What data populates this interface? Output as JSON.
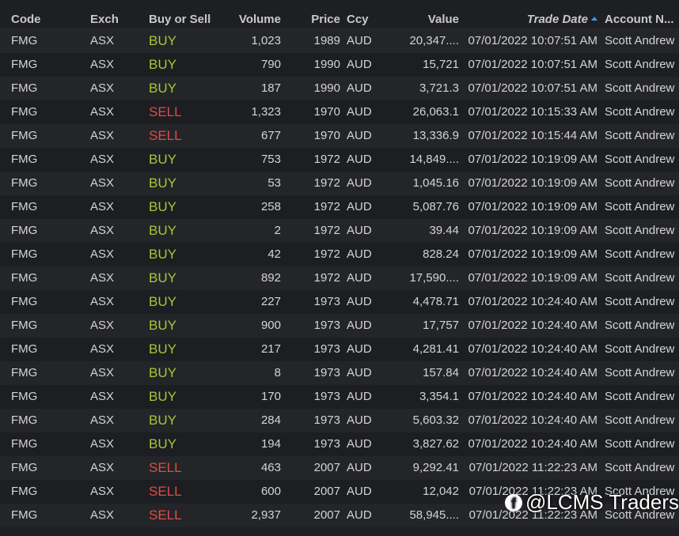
{
  "columns": {
    "code": "Code",
    "exch": "Exch",
    "side": "Buy or Sell",
    "volume": "Volume",
    "price": "Price",
    "ccy": "Ccy",
    "value": "Value",
    "trade_date": "Trade Date",
    "account": "Account N..."
  },
  "sort": {
    "column": "trade_date",
    "direction": "ascending",
    "icon": "sort-up-icon"
  },
  "colors": {
    "buy": "#a3c93a",
    "sell": "#e24a4a",
    "sort_arrow": "#3b9be8"
  },
  "rows": [
    {
      "code": "FMG",
      "exch": "ASX",
      "side": "BUY",
      "volume": "1,023",
      "price": "1989",
      "ccy": "AUD",
      "value": "20,347....",
      "trade_date": "07/01/2022 10:07:51 AM",
      "account": "Scott Andrew"
    },
    {
      "code": "FMG",
      "exch": "ASX",
      "side": "BUY",
      "volume": "790",
      "price": "1990",
      "ccy": "AUD",
      "value": "15,721",
      "trade_date": "07/01/2022 10:07:51 AM",
      "account": "Scott Andrew"
    },
    {
      "code": "FMG",
      "exch": "ASX",
      "side": "BUY",
      "volume": "187",
      "price": "1990",
      "ccy": "AUD",
      "value": "3,721.3",
      "trade_date": "07/01/2022 10:07:51 AM",
      "account": "Scott Andrew"
    },
    {
      "code": "FMG",
      "exch": "ASX",
      "side": "SELL",
      "volume": "1,323",
      "price": "1970",
      "ccy": "AUD",
      "value": "26,063.1",
      "trade_date": "07/01/2022 10:15:33 AM",
      "account": "Scott Andrew"
    },
    {
      "code": "FMG",
      "exch": "ASX",
      "side": "SELL",
      "volume": "677",
      "price": "1970",
      "ccy": "AUD",
      "value": "13,336.9",
      "trade_date": "07/01/2022 10:15:44 AM",
      "account": "Scott Andrew"
    },
    {
      "code": "FMG",
      "exch": "ASX",
      "side": "BUY",
      "volume": "753",
      "price": "1972",
      "ccy": "AUD",
      "value": "14,849....",
      "trade_date": "07/01/2022 10:19:09 AM",
      "account": "Scott Andrew"
    },
    {
      "code": "FMG",
      "exch": "ASX",
      "side": "BUY",
      "volume": "53",
      "price": "1972",
      "ccy": "AUD",
      "value": "1,045.16",
      "trade_date": "07/01/2022 10:19:09 AM",
      "account": "Scott Andrew"
    },
    {
      "code": "FMG",
      "exch": "ASX",
      "side": "BUY",
      "volume": "258",
      "price": "1972",
      "ccy": "AUD",
      "value": "5,087.76",
      "trade_date": "07/01/2022 10:19:09 AM",
      "account": "Scott Andrew"
    },
    {
      "code": "FMG",
      "exch": "ASX",
      "side": "BUY",
      "volume": "2",
      "price": "1972",
      "ccy": "AUD",
      "value": "39.44",
      "trade_date": "07/01/2022 10:19:09 AM",
      "account": "Scott Andrew"
    },
    {
      "code": "FMG",
      "exch": "ASX",
      "side": "BUY",
      "volume": "42",
      "price": "1972",
      "ccy": "AUD",
      "value": "828.24",
      "trade_date": "07/01/2022 10:19:09 AM",
      "account": "Scott Andrew"
    },
    {
      "code": "FMG",
      "exch": "ASX",
      "side": "BUY",
      "volume": "892",
      "price": "1972",
      "ccy": "AUD",
      "value": "17,590....",
      "trade_date": "07/01/2022 10:19:09 AM",
      "account": "Scott Andrew"
    },
    {
      "code": "FMG",
      "exch": "ASX",
      "side": "BUY",
      "volume": "227",
      "price": "1973",
      "ccy": "AUD",
      "value": "4,478.71",
      "trade_date": "07/01/2022 10:24:40 AM",
      "account": "Scott Andrew"
    },
    {
      "code": "FMG",
      "exch": "ASX",
      "side": "BUY",
      "volume": "900",
      "price": "1973",
      "ccy": "AUD",
      "value": "17,757",
      "trade_date": "07/01/2022 10:24:40 AM",
      "account": "Scott Andrew"
    },
    {
      "code": "FMG",
      "exch": "ASX",
      "side": "BUY",
      "volume": "217",
      "price": "1973",
      "ccy": "AUD",
      "value": "4,281.41",
      "trade_date": "07/01/2022 10:24:40 AM",
      "account": "Scott Andrew"
    },
    {
      "code": "FMG",
      "exch": "ASX",
      "side": "BUY",
      "volume": "8",
      "price": "1973",
      "ccy": "AUD",
      "value": "157.84",
      "trade_date": "07/01/2022 10:24:40 AM",
      "account": "Scott Andrew"
    },
    {
      "code": "FMG",
      "exch": "ASX",
      "side": "BUY",
      "volume": "170",
      "price": "1973",
      "ccy": "AUD",
      "value": "3,354.1",
      "trade_date": "07/01/2022 10:24:40 AM",
      "account": "Scott Andrew"
    },
    {
      "code": "FMG",
      "exch": "ASX",
      "side": "BUY",
      "volume": "284",
      "price": "1973",
      "ccy": "AUD",
      "value": "5,603.32",
      "trade_date": "07/01/2022 10:24:40 AM",
      "account": "Scott Andrew"
    },
    {
      "code": "FMG",
      "exch": "ASX",
      "side": "BUY",
      "volume": "194",
      "price": "1973",
      "ccy": "AUD",
      "value": "3,827.62",
      "trade_date": "07/01/2022 10:24:40 AM",
      "account": "Scott Andrew"
    },
    {
      "code": "FMG",
      "exch": "ASX",
      "side": "SELL",
      "volume": "463",
      "price": "2007",
      "ccy": "AUD",
      "value": "9,292.41",
      "trade_date": "07/01/2022 11:22:23 AM",
      "account": "Scott Andrew"
    },
    {
      "code": "FMG",
      "exch": "ASX",
      "side": "SELL",
      "volume": "600",
      "price": "2007",
      "ccy": "AUD",
      "value": "12,042",
      "trade_date": "07/01/2022 11:22:23 AM",
      "account": "Scott Andrew"
    },
    {
      "code": "FMG",
      "exch": "ASX",
      "side": "SELL",
      "volume": "2,937",
      "price": "2007",
      "ccy": "AUD",
      "value": "58,945....",
      "trade_date": "07/01/2022 11:22:23 AM",
      "account": "Scott Andrew"
    }
  ],
  "watermark": {
    "icon": "facebook-icon",
    "icon_glyph": "f",
    "text": "@LCMS Traders"
  }
}
